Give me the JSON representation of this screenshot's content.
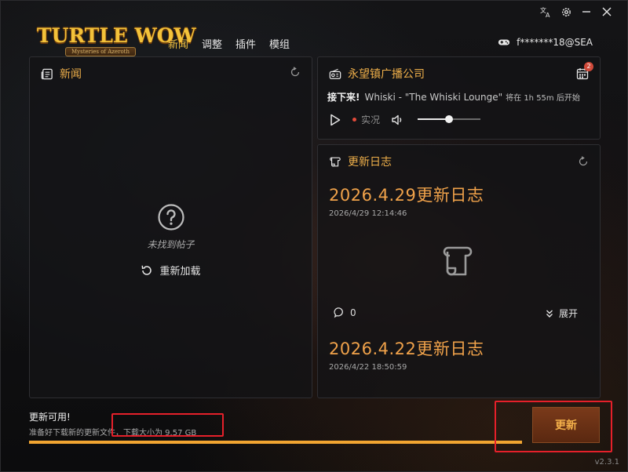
{
  "logo": {
    "word": "TURTLE WOW",
    "subtitle": "Mysteries of Azeroth"
  },
  "nav": {
    "items": [
      "新闻",
      "调整",
      "插件",
      "模组"
    ],
    "active": "新闻"
  },
  "account": {
    "name": "f*******18@SEA"
  },
  "news": {
    "title": "新闻",
    "empty_message": "未找到帖子",
    "reload_label": "重新加载"
  },
  "radio": {
    "title": "永望镇广播公司",
    "up_next_label": "接下来!",
    "track": "Whiski - \"The Whiski Lounge\"",
    "starts_text": "将在 1h 55m 后开始",
    "live_label": "实况",
    "volume_fraction": 0.5,
    "calendar_badge": "2"
  },
  "changelog": {
    "title": "更新日志",
    "entries": [
      {
        "title": "2026.4.29更新日志",
        "date": "2026/4/29 12:14:46",
        "comments": "0",
        "expand_label": "展开"
      },
      {
        "title": "2026.4.22更新日志",
        "date": "2026/4/22 18:50:59"
      }
    ]
  },
  "update": {
    "title": "更新可用!",
    "description": "准备好下载新的更新文件，下载大小为 9.57 GB",
    "button_label": "更新",
    "progress_fraction": 1.0
  },
  "version": "v2.3.1",
  "colors": {
    "accent": "#f0a24a",
    "highlight": "#e5202a",
    "progress": "#f2a531"
  }
}
